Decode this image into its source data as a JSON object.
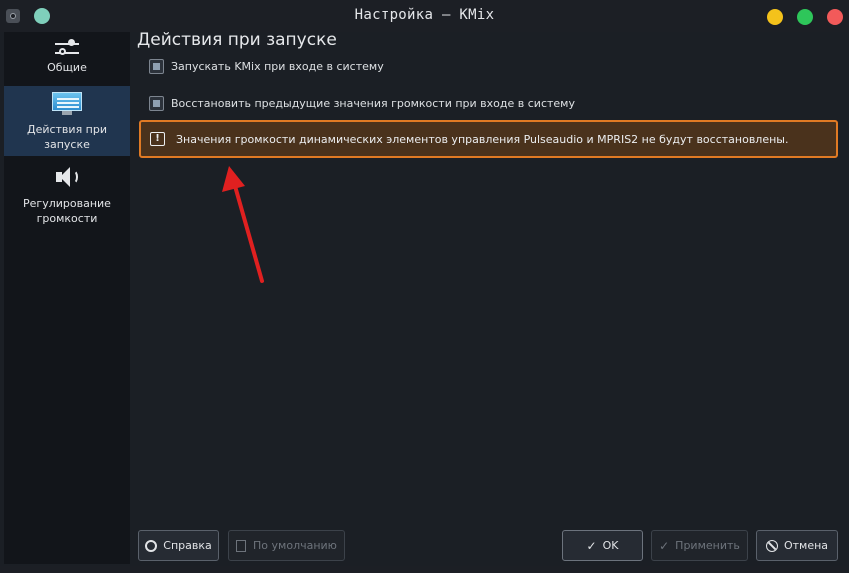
{
  "window": {
    "title": "Настройка — KMix"
  },
  "sidebar": {
    "items": [
      {
        "label": "Общие",
        "icon": "sliders-icon",
        "active": false
      },
      {
        "label": "Действия при запуске",
        "icon": "monitor-icon",
        "active": true
      },
      {
        "label": "Регулирование громкости",
        "icon": "speaker-icon",
        "active": false
      }
    ]
  },
  "main": {
    "title": "Действия при запуске",
    "checkboxes": [
      {
        "label": "Запускать KMix при входе в систему",
        "checked": false
      },
      {
        "label": "Восстановить предыдущие значения громкости при входе в систему",
        "checked": false
      }
    ],
    "warning": {
      "text": "Значения громкости динамических элементов управления Pulseaudio и MPRIS2 не будут восстановлены.",
      "icon": "warning-icon"
    }
  },
  "buttons": {
    "help": "Справка",
    "defaults": "По умолчанию",
    "ok": "OK",
    "apply": "Применить",
    "cancel": "Отмена"
  },
  "colors": {
    "accent_active": "#20354f",
    "warning_border": "#e07a24",
    "annotation_arrow": "#e02020"
  }
}
